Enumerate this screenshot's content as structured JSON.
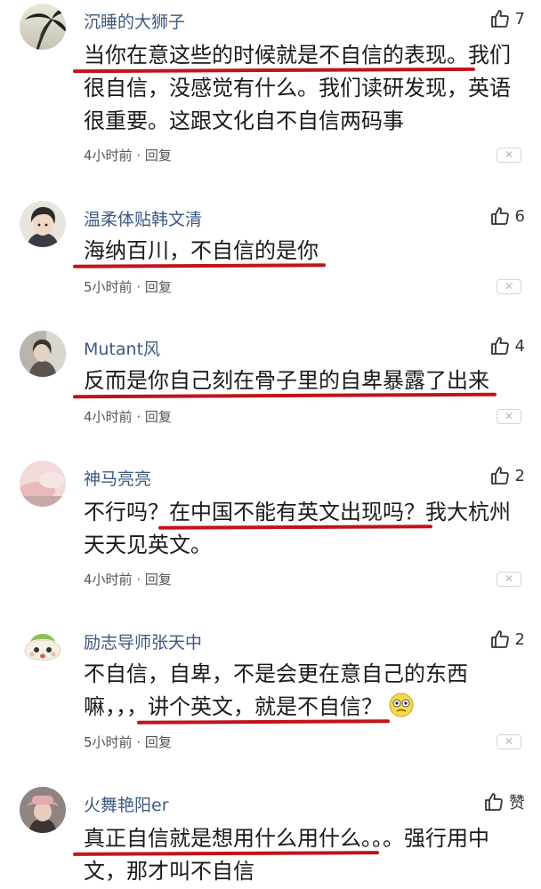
{
  "comments": [
    {
      "username": "沉睡的大狮子",
      "likes": "7",
      "text_hl": "当你在意这些的时候就是不自信的表现。",
      "text_rest": "我们很自信，没感觉有什么。我们读研发现，英语很重要。这跟文化自不自信两码事",
      "time": "4小时前",
      "reply": "回复",
      "avatar_icon": "palm-tree-silhouette"
    },
    {
      "username": "温柔体贴韩文清",
      "likes": "6",
      "text_hl": "海纳百川，不自信的是你",
      "time": "5小时前",
      "reply": "回复",
      "avatar_icon": "anime-character"
    },
    {
      "username": "Mutant风",
      "likes": "4",
      "text_hl": "反而是你自己刻在骨子里的自卑暴露了出来",
      "time": "4小时前",
      "reply": "回复",
      "avatar_icon": "person-photo"
    },
    {
      "username": "神马亮亮",
      "likes": "2",
      "text_pre": "不行吗？",
      "text_hl": "在中国不能有英文出现吗？",
      "text_rest": "我大杭州天天见英文。",
      "time": "4小时前",
      "reply": "回复",
      "avatar_icon": "pink-blurred-photo"
    },
    {
      "username": "励志导师张天中",
      "likes": "2",
      "text_pre": "不自信，自卑，不是会更在意自己的东西嘛，，，",
      "text_hl": "讲个英文，就是不自信？",
      "time": "5小时前",
      "reply": "回复",
      "avatar_icon": "cartoon-creature",
      "emoji_icon": "confused-emoji"
    },
    {
      "username": "火舞艳阳er",
      "likes": "赞",
      "text_hl": "真正自信就是想用什么用什么。",
      "text_rest": "。。强行用中文，那才叫不自信",
      "avatar_icon": "woman-in-hat-photo"
    }
  ],
  "meta_separator": "·",
  "close_glyph": "✕",
  "colors": {
    "username": "#3d5a80",
    "underline": "#c0141b",
    "meta": "#555555"
  }
}
